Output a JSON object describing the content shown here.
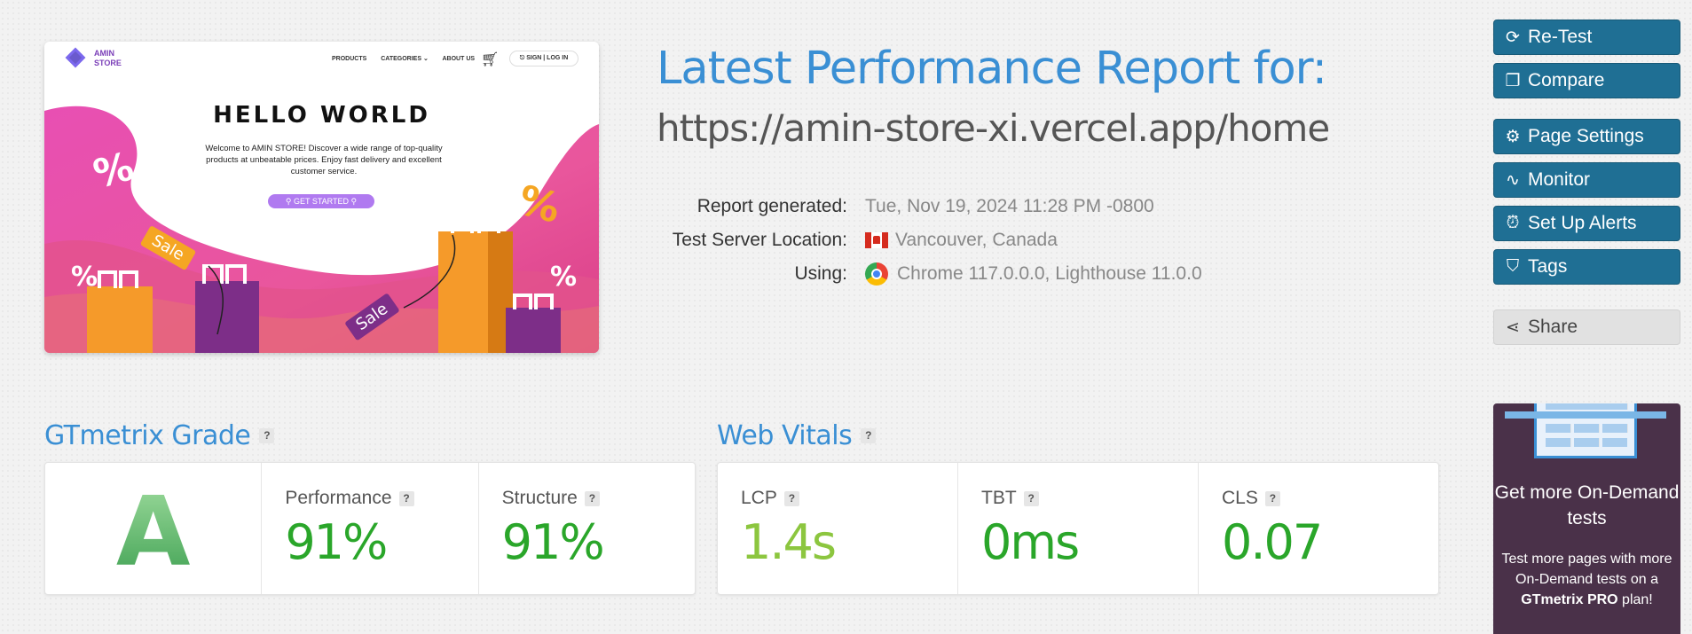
{
  "thumbnail": {
    "logo_line1": "AMIN",
    "logo_line2": "STORE",
    "nav": [
      "PRODUCTS",
      "CATEGORIES ⌄",
      "ABOUT US"
    ],
    "sign_in": "⎋ SIGN | LOG IN",
    "headline": "HELLO WORLD",
    "welcome": "Welcome to AMIN STORE! Discover a wide range of top-quality products at unbeatable prices. Enjoy fast delivery and excellent customer service.",
    "cta": "⚲ GET STARTED ⚲",
    "sale_tag": "Sale",
    "percent": "%"
  },
  "report": {
    "title": "Latest Performance Report for:",
    "url": "https://amin-store-xi.vercel.app/home",
    "rows": [
      {
        "label": "Report generated:",
        "value": "Tue, Nov 19, 2024 11:28 PM -0800"
      },
      {
        "label": "Test Server Location:",
        "value": "Vancouver, Canada"
      },
      {
        "label": "Using:",
        "value": "Chrome 117.0.0.0, Lighthouse 11.0.0"
      }
    ]
  },
  "sidebar": {
    "retest": "Re-Test",
    "compare": "Compare",
    "page_settings": "Page Settings",
    "monitor": "Monitor",
    "alerts": "Set Up Alerts",
    "tags": "Tags",
    "share": "Share"
  },
  "promo": {
    "heading": "Get more On-Demand tests",
    "text_prefix": "Test more pages with more On-Demand tests on a ",
    "brand": "GTmetrix PRO",
    "text_suffix": " plan!"
  },
  "grade": {
    "title": "GTmetrix Grade",
    "help": "?",
    "letter": "A",
    "performance_label": "Performance",
    "performance_value": "91%",
    "structure_label": "Structure",
    "structure_value": "91%"
  },
  "vitals": {
    "title": "Web Vitals",
    "help": "?",
    "lcp_label": "LCP",
    "lcp_value": "1.4s",
    "tbt_label": "TBT",
    "tbt_value": "0ms",
    "cls_label": "CLS",
    "cls_value": "0.07"
  },
  "colors": {
    "accent_blue": "#3a8fd4",
    "button_teal": "#1f6f94",
    "good_green": "#2aa62a",
    "lcp_green": "#8cc63f",
    "promo_bg": "#4a3149"
  }
}
